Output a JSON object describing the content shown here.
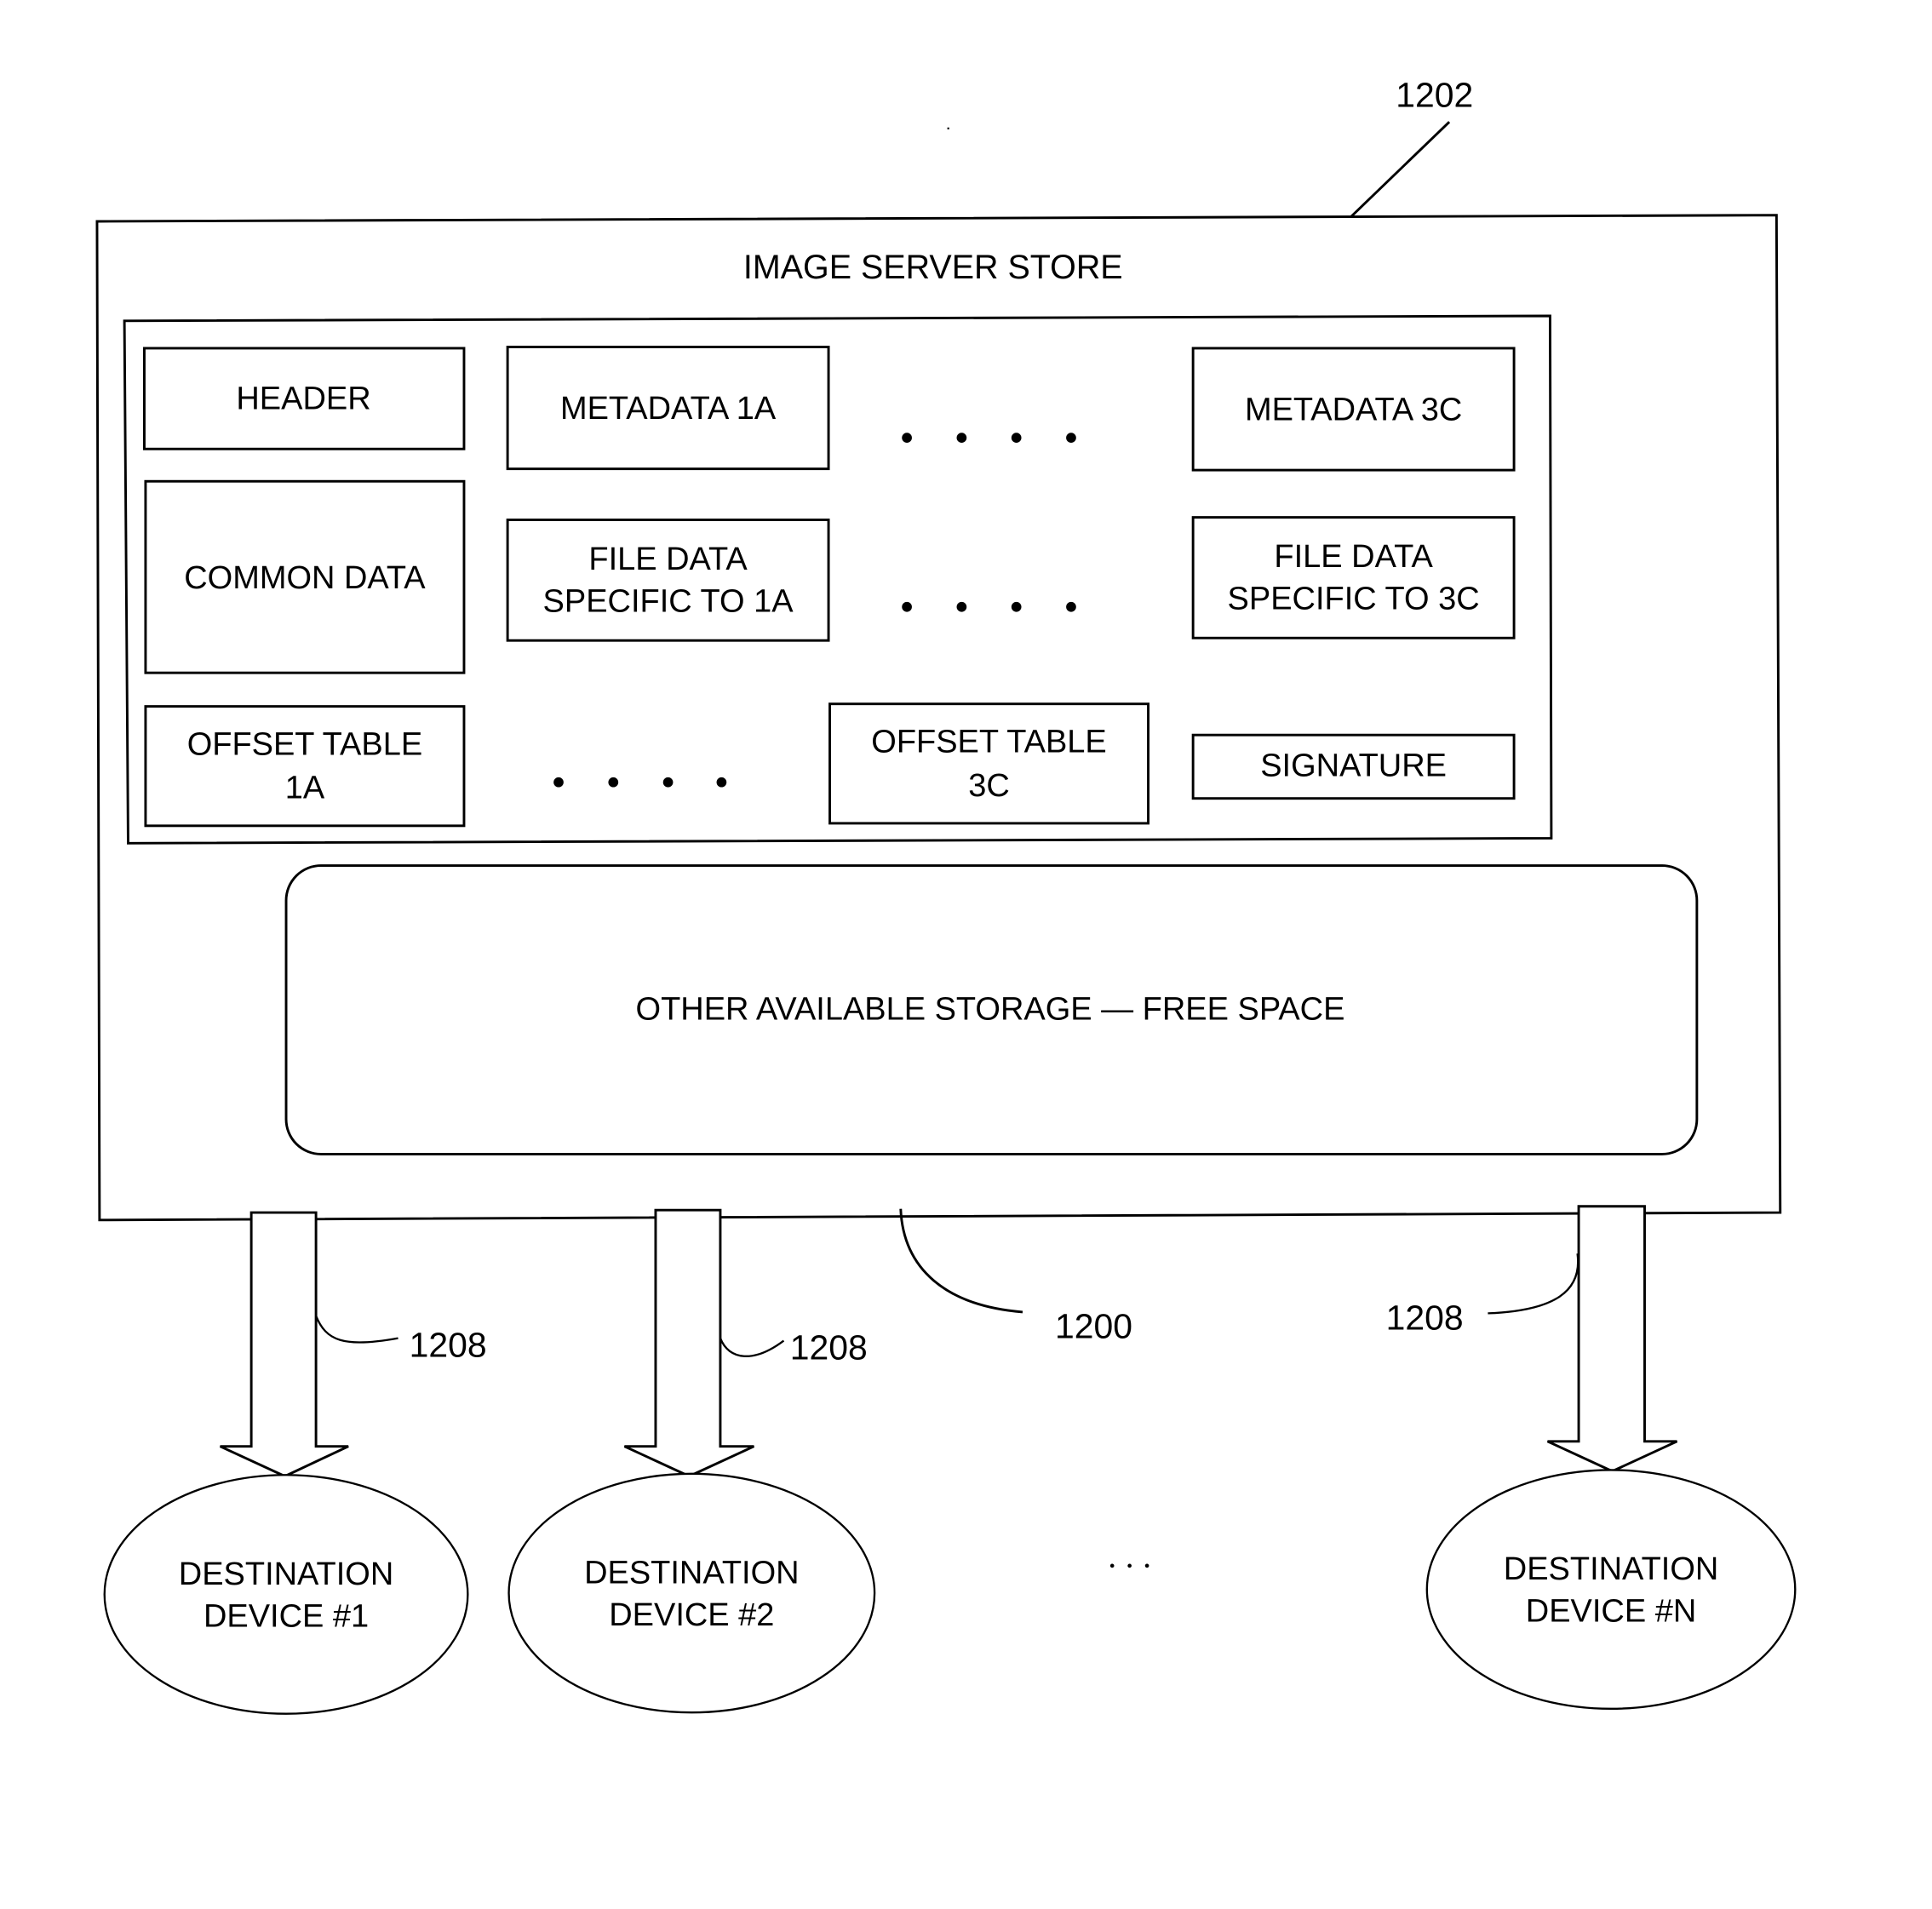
{
  "figure": {
    "reference_numeral_structure": "1202",
    "reference_numeral_store": "1200",
    "reference_numeral_links": [
      "1208",
      "1208",
      "1208"
    ]
  },
  "store": {
    "title": "IMAGE SERVER STORE",
    "structure": {
      "header": "HEADER",
      "common_data": "COMMON DATA",
      "metadata_1a": "METADATA 1A",
      "metadata_3c": "METADATA 3C",
      "file_data_1a": [
        "FILE DATA",
        "SPECIFIC TO 1A"
      ],
      "file_data_3c": [
        "FILE DATA",
        "SPECIFIC TO 3C"
      ],
      "offset_table_1a": [
        "OFFSET TABLE",
        "1A"
      ],
      "offset_table_3c": [
        "OFFSET TABLE",
        "3C"
      ],
      "signature": "SIGNATURE"
    },
    "free_space": "OTHER AVAILABLE STORAGE — FREE SPACE"
  },
  "devices": [
    {
      "line1": "DESTINATION",
      "line2": "DEVICE #1"
    },
    {
      "line1": "DESTINATION",
      "line2": "DEVICE #2"
    },
    {
      "line1": "DESTINATION",
      "line2": "DEVICE #N"
    }
  ]
}
